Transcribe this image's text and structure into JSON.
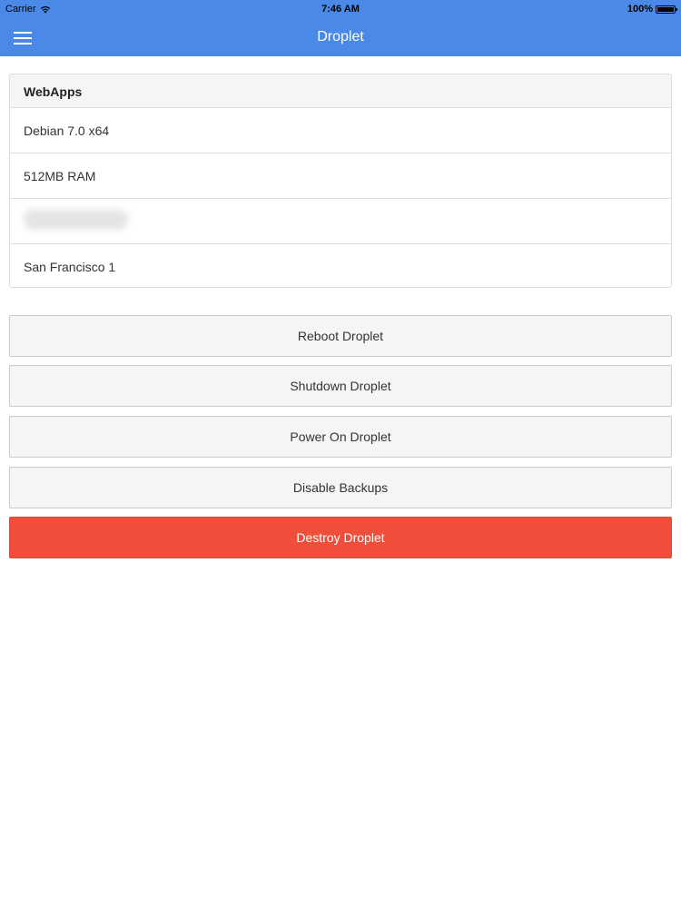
{
  "status_bar": {
    "carrier": "Carrier",
    "time": "7:46 AM",
    "battery": "100%"
  },
  "nav": {
    "title": "Droplet",
    "menu_icon": "hamburger-menu-icon"
  },
  "droplet": {
    "name": "WebApps",
    "details": [
      "Debian 7.0 x64",
      "512MB RAM",
      "",
      "San Francisco 1"
    ]
  },
  "actions": {
    "reboot": "Reboot Droplet",
    "shutdown": "Shutdown Droplet",
    "power_on": "Power On Droplet",
    "disable_backups": "Disable Backups",
    "destroy": "Destroy Droplet"
  },
  "colors": {
    "header": "#4a89e8",
    "danger": "#ef4f3a"
  }
}
